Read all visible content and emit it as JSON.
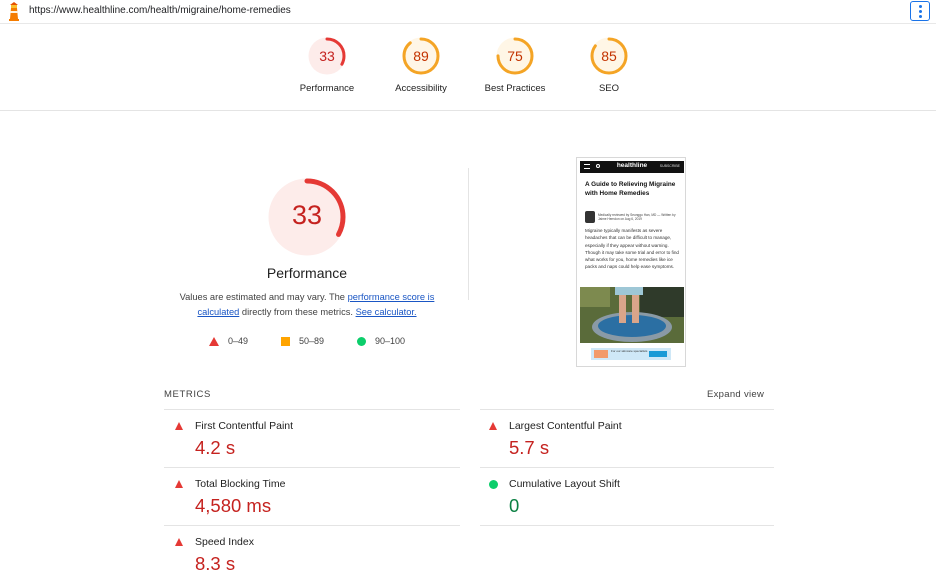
{
  "browser": {
    "url": "https://www.healthline.com/health/migraine/home-remedies"
  },
  "summary": [
    {
      "score": "33",
      "label": "Performance",
      "value": 0.33,
      "color": "#e53935",
      "text_color": "#c5221f",
      "bg": "#fdecea"
    },
    {
      "score": "89",
      "label": "Accessibility",
      "value": 0.89,
      "color": "#f4a425",
      "text_color": "#c33300",
      "bg": "#fff6e6"
    },
    {
      "score": "75",
      "label": "Best Practices",
      "value": 0.75,
      "color": "#f4a425",
      "text_color": "#c33300",
      "bg": "#fff6e6"
    },
    {
      "score": "85",
      "label": "SEO",
      "value": 0.85,
      "color": "#f4a425",
      "text_color": "#c33300",
      "bg": "#fff6e6"
    }
  ],
  "performance": {
    "score": "33",
    "value": 0.33,
    "title": "Performance",
    "note_before": "Values are estimated and may vary. The ",
    "note_link1": "performance score is calculated",
    "note_middle": " directly from these metrics. ",
    "note_link2": "See calculator.",
    "legend": [
      {
        "shape": "triangle",
        "label": "0–49",
        "color": "#e53935"
      },
      {
        "shape": "square",
        "label": "50–89",
        "color": "#ffa400"
      },
      {
        "shape": "circle",
        "label": "90–100",
        "color": "#0cce6b"
      }
    ]
  },
  "screenshot": {
    "brand": "healthline",
    "subscribe": "SUBSCRIBE",
    "title": "A Guide to Relieving Migraine with Home Remedies",
    "byline": "Medically reviewed by Seunggu Han, MD — Written by Jaime Herndon on Aug 6, 2019",
    "body": "Migraine typically manifests as severe headaches that can be difficult to manage, especially if they appear without warning. Though it may take some trial and error to find what works for you, home remedies like ice packs and naps could help ease symptoms.",
    "ad_text": "For our skincare specialists"
  },
  "metrics": {
    "header": "METRICS",
    "expand": "Expand view",
    "items": [
      {
        "name": "First Contentful Paint",
        "value": "4.2 s",
        "status": "poor"
      },
      {
        "name": "Largest Contentful Paint",
        "value": "5.7 s",
        "status": "poor"
      },
      {
        "name": "Total Blocking Time",
        "value": "4,580 ms",
        "status": "poor"
      },
      {
        "name": "Cumulative Layout Shift",
        "value": "0",
        "status": "good"
      },
      {
        "name": "Speed Index",
        "value": "8.3 s",
        "status": "poor"
      }
    ]
  },
  "icons": {
    "logo": "lighthouse-icon",
    "menu": "more-vert-icon",
    "poor": "triangle-icon",
    "good": "circle-icon"
  }
}
